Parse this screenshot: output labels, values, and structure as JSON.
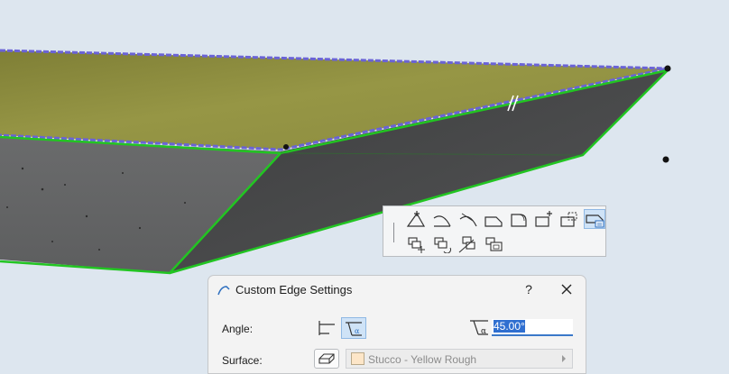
{
  "dialog": {
    "title": "Custom Edge Settings",
    "help_label": "?",
    "angle_label": "Angle:",
    "angle_value": "45.00°",
    "surface_label": "Surface:",
    "surface_value": "Stucco - Yellow Rough"
  },
  "colors": {
    "background": "#dde6ef",
    "selection_green": "#22c522",
    "edge_highlight": "#6a63d6",
    "top_surface": "#8a8a3e",
    "side_concrete": "#4e4f50",
    "surface_swatch": "#fde6c8",
    "input_selection": "#2f6fd0"
  },
  "icons": {
    "palette": [
      "add-node-icon",
      "curve-edge-icon",
      "tangent-edge-icon",
      "offset-edge-icon",
      "fillet-icon",
      "add-polygon-icon",
      "subtract-polygon-icon",
      "custom-edge-settings-icon",
      "move-polygon-icon",
      "rotate-polygon-icon",
      "mirror-polygon-icon",
      "offset-polygon-icon"
    ],
    "angle_options": [
      "vertical-edge-icon",
      "custom-angle-edge-icon"
    ]
  }
}
